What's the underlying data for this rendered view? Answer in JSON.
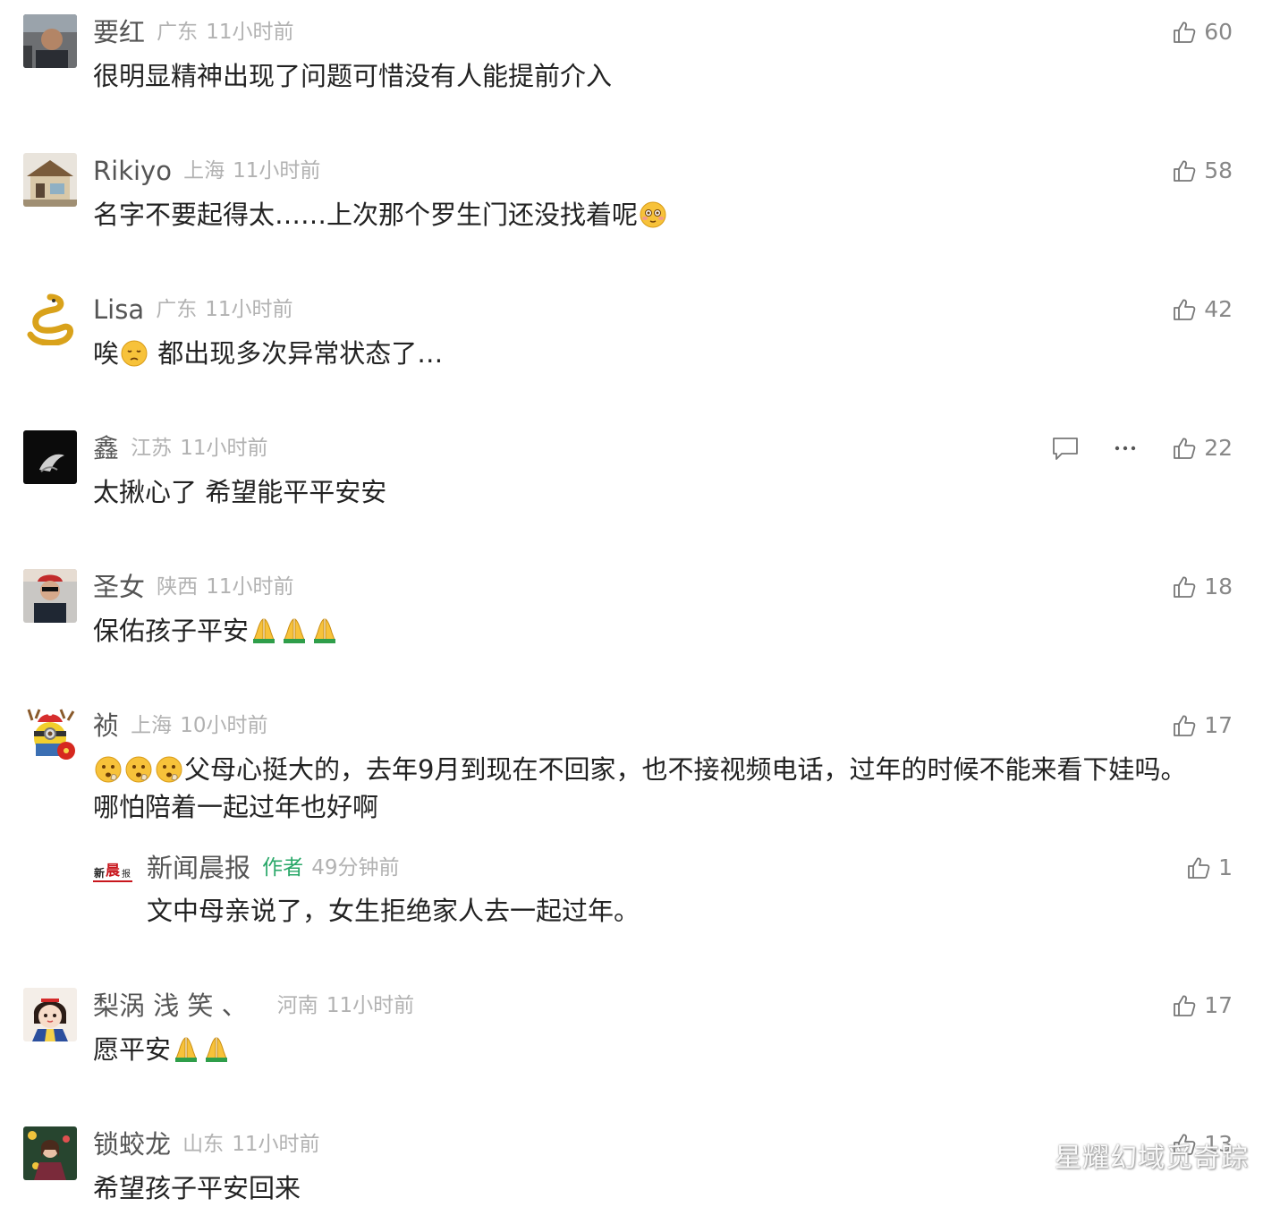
{
  "comments": [
    {
      "username": "要红",
      "location": "广东",
      "time": "11小时前",
      "likes": "60",
      "text": "很明显精神出现了问题可惜没有人能提前介入"
    },
    {
      "username": "Rikiyo",
      "location": "上海",
      "time": "11小时前",
      "likes": "58",
      "text": "名字不要起得太……上次那个罗生门还没找着呢"
    },
    {
      "username": "Lisa",
      "location": "广东",
      "time": "11小时前",
      "likes": "42",
      "text_pre": "唉",
      "text": " 都出现多次异常状态了…"
    },
    {
      "username": "鑫",
      "location": "江苏",
      "time": "11小时前",
      "likes": "22",
      "text": "太揪心了 希望能平平安安"
    },
    {
      "username": "圣女",
      "location": "陕西",
      "time": "11小时前",
      "likes": "18",
      "text": "保佑孩子平安"
    },
    {
      "username": "祯",
      "location": "上海",
      "time": "10小时前",
      "likes": "17",
      "text": "父母心挺大的，去年9月到现在不回家，也不接视频电话，过年的时候不能来看下娃吗。",
      "text2": "哪怕陪着一起过年也好啊"
    },
    {
      "username": "梨涡 浅 笑 、",
      "location": "河南",
      "time": "11小时前",
      "likes": "17",
      "text": "愿平安"
    },
    {
      "username": "锁蛟龙",
      "location": "山东",
      "time": "11小时前",
      "likes": "13",
      "text": "希望孩子平安回来"
    }
  ],
  "reply": {
    "username": "新闻晨报",
    "author_tag": "作者",
    "time": "49分钟前",
    "likes": "1",
    "text": "文中母亲说了，女生拒绝家人去一起过年。",
    "avatar_text": "新闻晨报"
  },
  "watermark": "星耀幻域觅奇踪",
  "icons": {
    "like": "thumbs-up-icon",
    "reply": "comment-bubble-icon",
    "more": "more-dots-icon"
  }
}
